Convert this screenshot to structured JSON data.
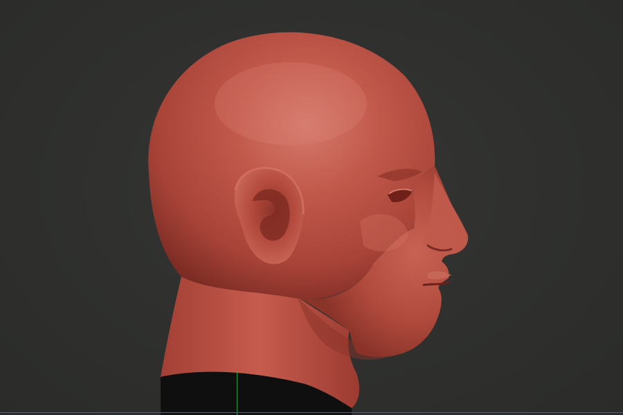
{
  "viewport": {
    "background_color": "#2f302e",
    "model": {
      "subject": "sculpted-head-profile",
      "material_color": "#b6473a",
      "highlight_color": "#d9786b",
      "shadow_color": "#7a2a22",
      "base_color": "#0f0f0f"
    },
    "gizmo": {
      "y_axis_color": "#2f9a3a",
      "x_axis_color": "#5a5f6a"
    }
  }
}
